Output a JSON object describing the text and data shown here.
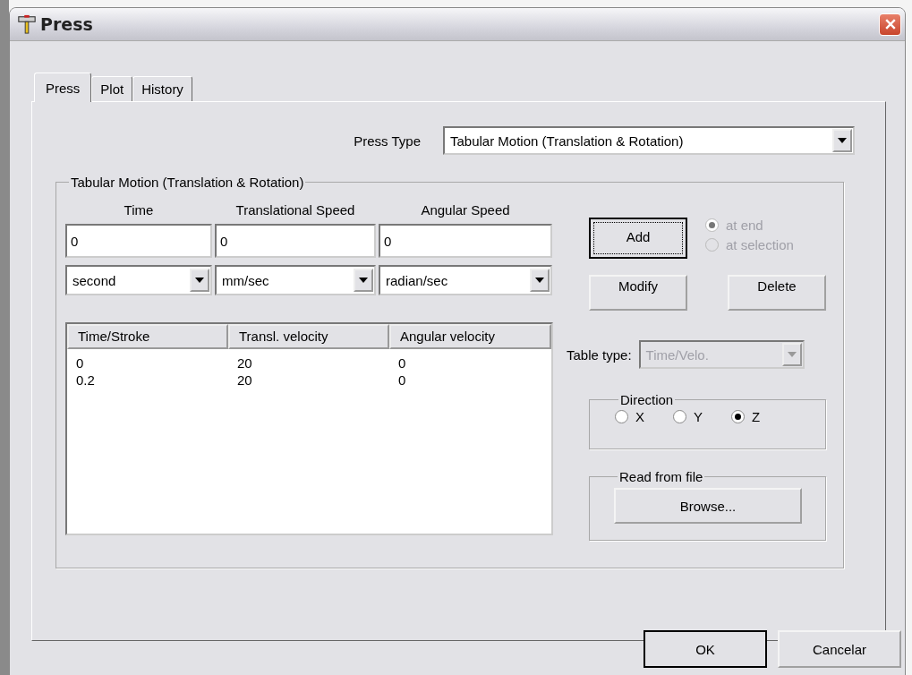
{
  "window": {
    "title": "Press"
  },
  "tabs": [
    {
      "label": "Press",
      "selected": true
    },
    {
      "label": "Plot",
      "selected": false
    },
    {
      "label": "History",
      "selected": false
    }
  ],
  "press_type": {
    "label": "Press Type",
    "value": "Tabular Motion (Translation & Rotation)"
  },
  "group": {
    "title": "Tabular Motion (Translation & Rotation)",
    "fields": [
      {
        "label": "Time",
        "value": "0",
        "unit": "second"
      },
      {
        "label": "Translational Speed",
        "value": "0",
        "unit": "mm/sec"
      },
      {
        "label": "Angular Speed",
        "value": "0",
        "unit": "radian/sec"
      }
    ],
    "table": {
      "columns": [
        "Time/Stroke",
        "Transl. velocity",
        "Angular velocity"
      ],
      "rows": [
        [
          "0",
          "20",
          "0"
        ],
        [
          "0.2",
          "20",
          "0"
        ]
      ]
    },
    "buttons": [
      {
        "label": "Add",
        "focused": true
      },
      {
        "label": "Modify",
        "focused": false
      },
      {
        "label": "Delete",
        "focused": false
      }
    ],
    "insert_options": [
      {
        "label": "at end",
        "selected": true,
        "disabled": true
      },
      {
        "label": "at selection",
        "selected": false,
        "disabled": true
      }
    ],
    "table_type": {
      "label": "Table type:",
      "value": "Time/Velo.",
      "disabled": true
    },
    "direction": {
      "title": "Direction",
      "options": [
        {
          "label": "X",
          "selected": false
        },
        {
          "label": "Y",
          "selected": false
        },
        {
          "label": "Z",
          "selected": true
        }
      ]
    },
    "read_from_file": {
      "title": "Read from file",
      "button": "Browse..."
    }
  },
  "footer_buttons": [
    {
      "label": "OK",
      "default": true
    },
    {
      "label": "Cancelar",
      "default": false
    }
  ]
}
